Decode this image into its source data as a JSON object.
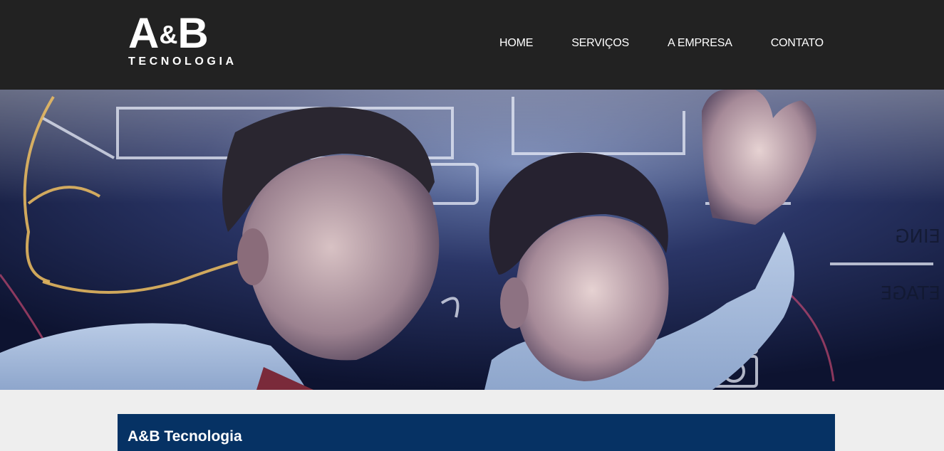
{
  "logo": {
    "main_a": "A",
    "amp": "&",
    "main_b": "B",
    "sub": "TECNOLOGIA"
  },
  "nav": {
    "items": [
      {
        "label": "HOME"
      },
      {
        "label": "SERVIÇOS"
      },
      {
        "label": "A EMPRESA"
      },
      {
        "label": "CONTATO"
      }
    ]
  },
  "hero": {
    "image": "two-men-drawing-on-glass-board"
  },
  "section": {
    "title": "A&B Tecnologia"
  },
  "colors": {
    "header_bg": "#222222",
    "page_bg": "#eeeeee",
    "title_bar_bg": "#063264",
    "text_light": "#ffffff"
  }
}
